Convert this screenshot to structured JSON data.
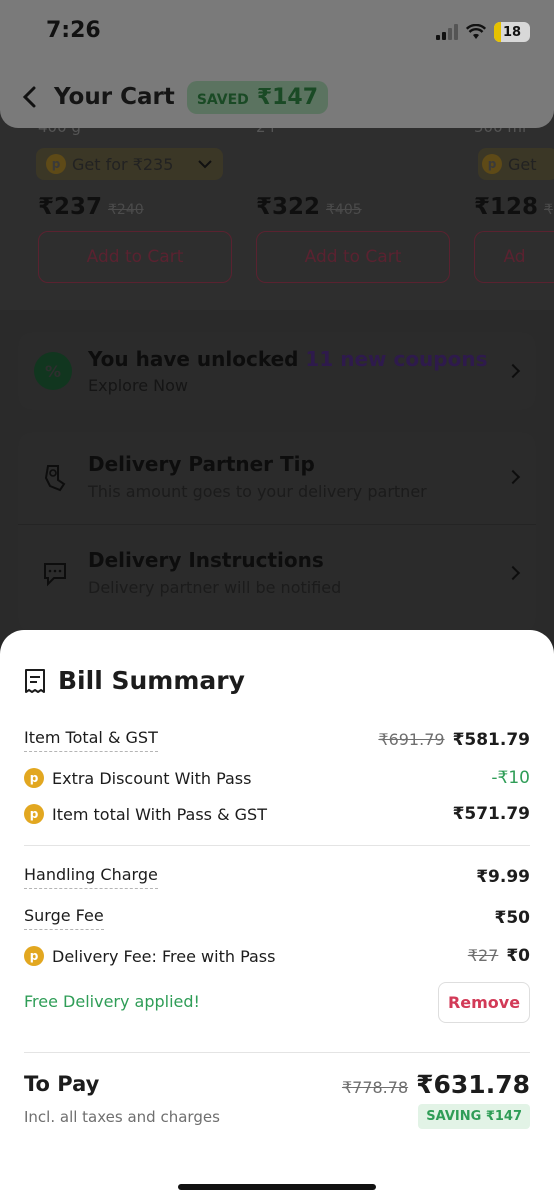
{
  "status": {
    "time": "7:26",
    "battery": "18"
  },
  "header": {
    "title": "Your Cart",
    "saved_label": "SAVED",
    "saved_amount": "₹147"
  },
  "products": [
    {
      "weight": "400 g",
      "pass_price": "Get for ₹235",
      "price": "₹237",
      "old_price": "₹240",
      "cta": "Add to Cart"
    },
    {
      "weight": "2 l",
      "price": "₹322",
      "old_price": "₹405",
      "cta": "Add to Cart"
    },
    {
      "weight": "500 ml",
      "pass_price": "Get",
      "price": "₹128",
      "old_price": "₹",
      "cta": "Ad"
    }
  ],
  "coupons": {
    "title_prefix": "You have unlocked ",
    "title_highlight": "11 new coupons",
    "subtitle": "Explore Now"
  },
  "options": [
    {
      "title": "Delivery Partner Tip",
      "subtitle": "This amount goes to your delivery partner",
      "icon": "tip-icon"
    },
    {
      "title": "Delivery Instructions",
      "subtitle": "Delivery partner will be notified",
      "icon": "message-icon"
    }
  ],
  "bill": {
    "title": "Bill Summary",
    "item_total": {
      "label": "Item Total & GST",
      "old": "₹691.79",
      "value": "₹581.79"
    },
    "extra_discount": {
      "label": "Extra Discount With Pass",
      "value": "-₹10"
    },
    "pass_total": {
      "label": "Item total With Pass & GST",
      "value": "₹571.79"
    },
    "handling": {
      "label": "Handling Charge",
      "value": "₹9.99"
    },
    "surge": {
      "label": "Surge Fee",
      "value": "₹50"
    },
    "delivery": {
      "label": "Delivery Fee: Free with Pass",
      "old": "₹27",
      "value": "₹0"
    },
    "free_delivery": "Free Delivery applied!",
    "remove_label": "Remove",
    "to_pay": {
      "label": "To Pay",
      "sub": "Incl. all taxes and charges",
      "old": "₹778.78",
      "value": "₹631.78",
      "saving": "SAVING ₹147"
    }
  },
  "colors": {
    "accent_green": "#2f9d57",
    "remove_red": "#d23a57",
    "pass_gold": "#e2a720"
  }
}
